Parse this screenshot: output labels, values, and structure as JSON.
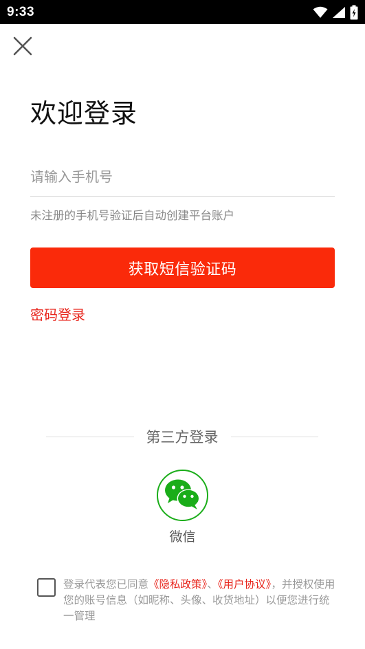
{
  "status_bar": {
    "time": "9:33"
  },
  "header": {
    "close_icon": "close-icon"
  },
  "login": {
    "title": "欢迎登录",
    "phone_placeholder": "请输入手机号",
    "phone_value": "",
    "hint": "未注册的手机号验证后自动创建平台账户",
    "sms_button_label": "获取短信验证码",
    "password_login_label": "密码登录"
  },
  "third_party": {
    "divider_label": "第三方登录",
    "wechat_icon": "wechat-icon",
    "wechat_label": "微信"
  },
  "agreement": {
    "checked": false,
    "prefix": "登录代表您已同意",
    "privacy_link": "《隐私政策》",
    "separator": "、",
    "user_agreement_link": "《用户协议》",
    "suffix": "，并授权使用您的账号信息（如昵称、头像、收货地址）以便您进行统一管理"
  },
  "colors": {
    "accent": "#fa2a0a",
    "link": "#e8251c",
    "wechat_green": "#1aad19",
    "status_bar": "#000000"
  }
}
